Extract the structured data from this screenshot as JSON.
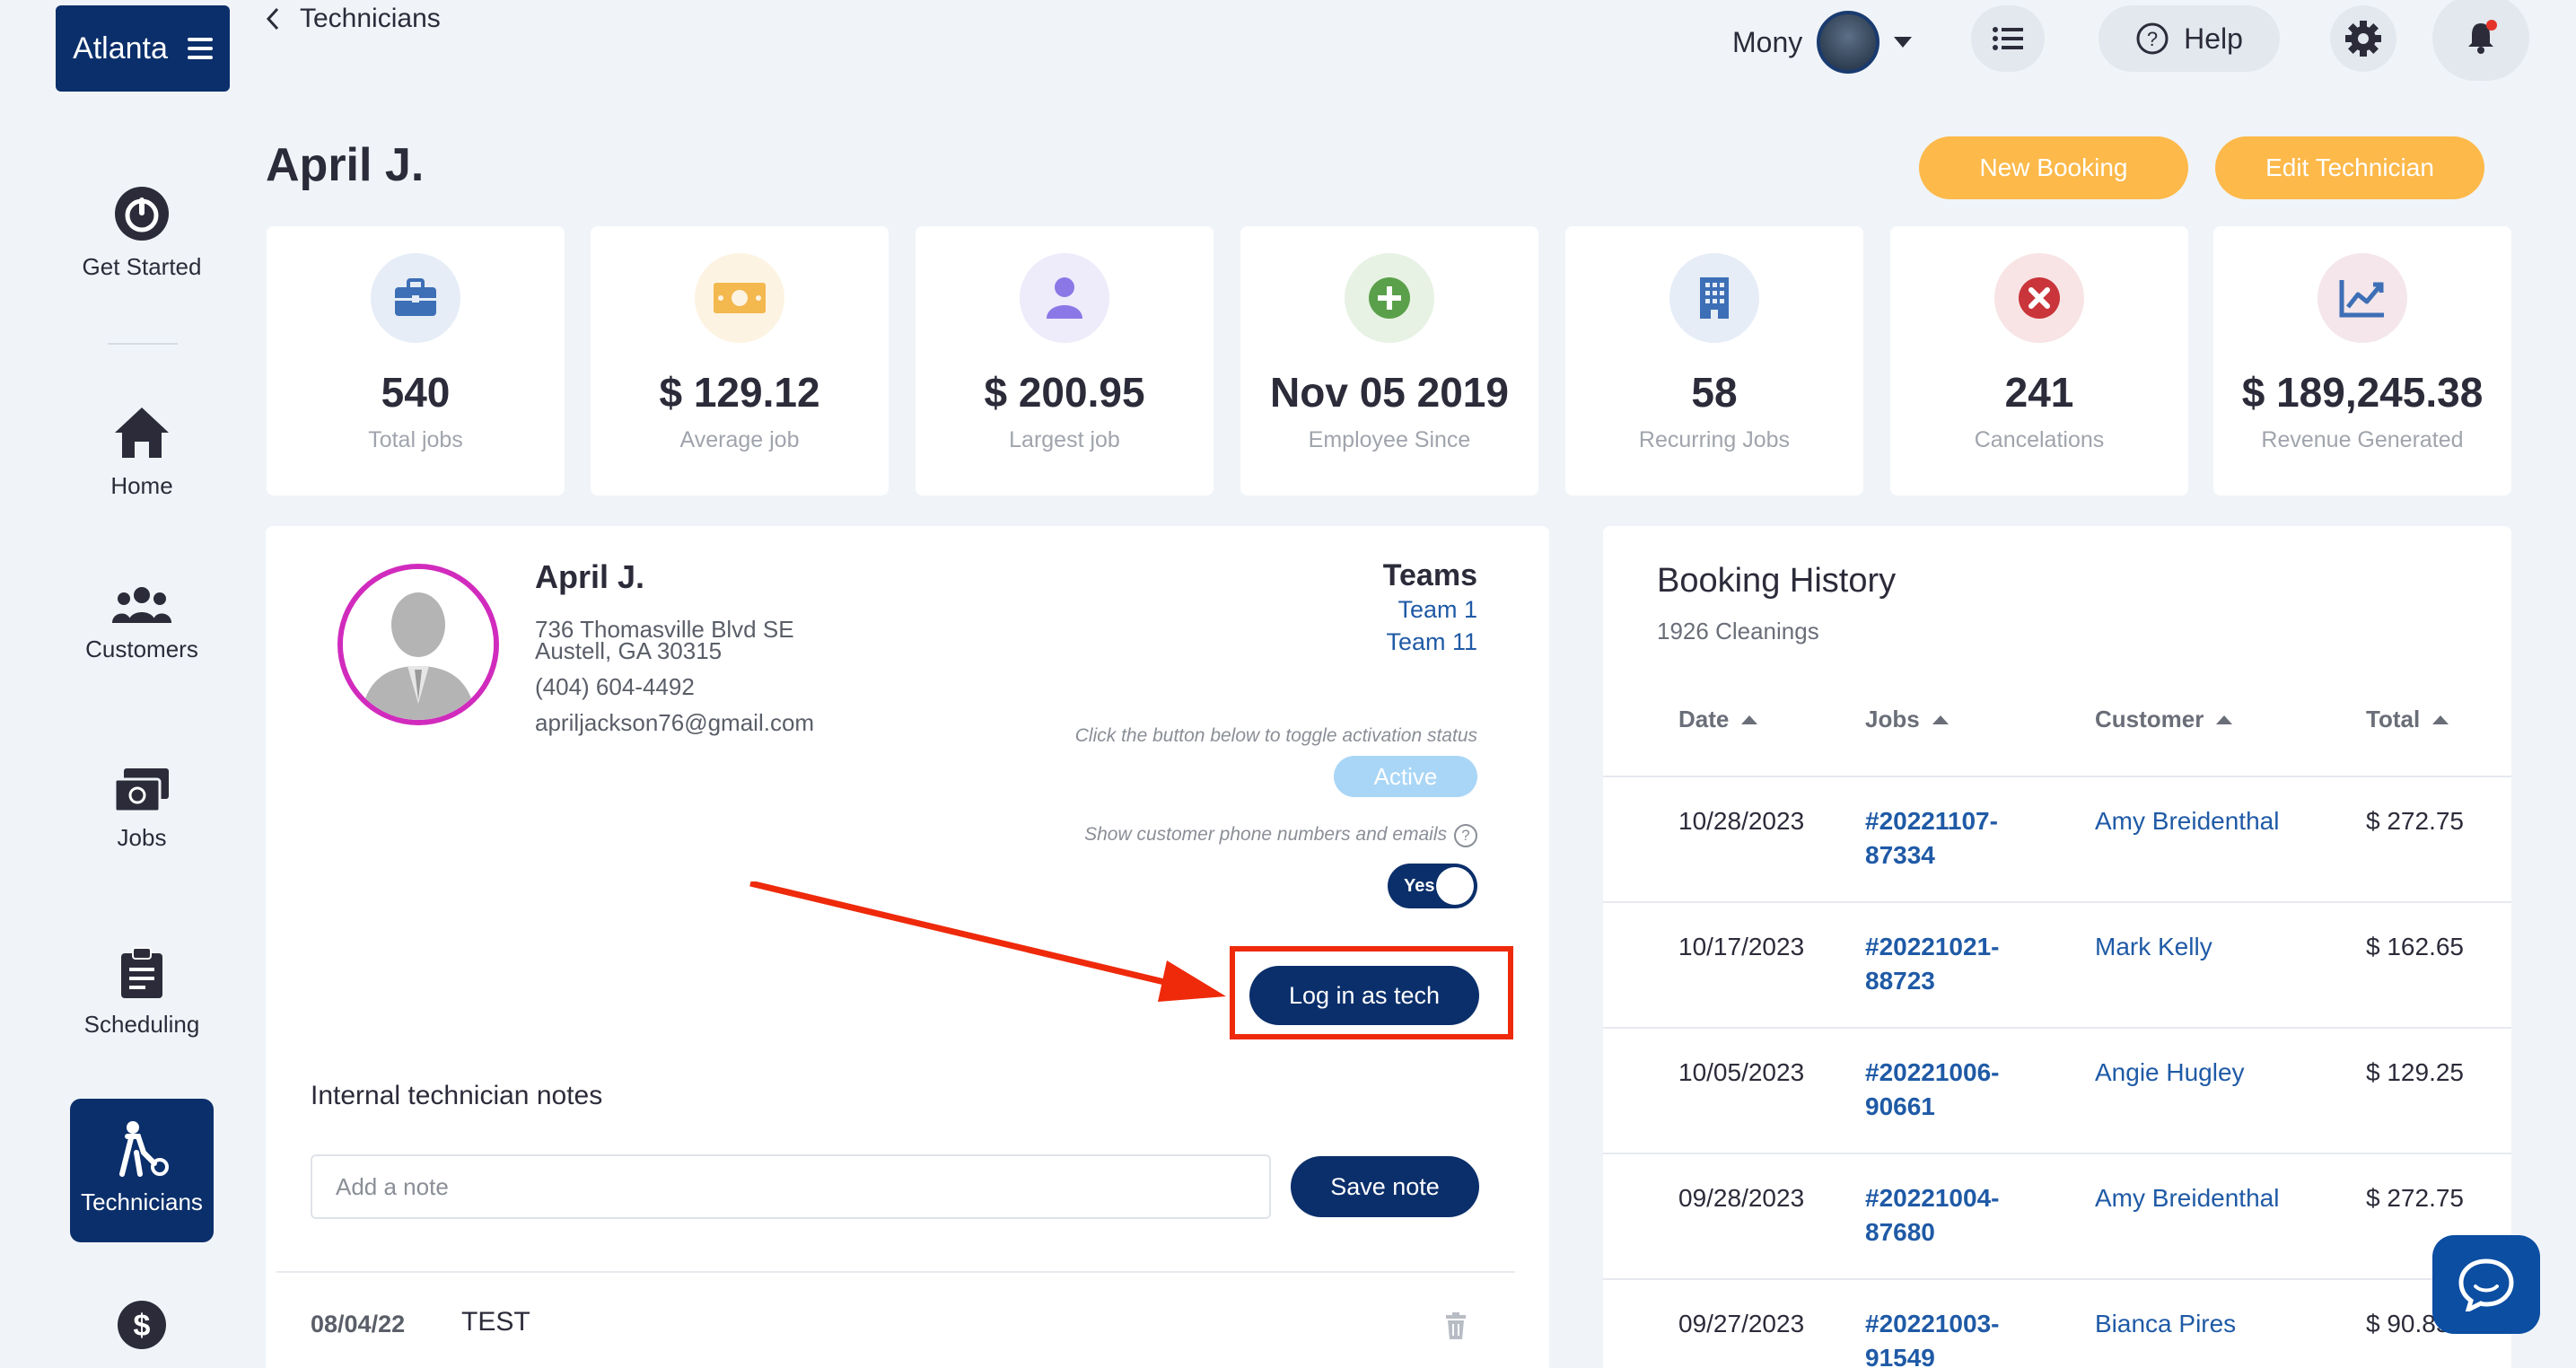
{
  "sidebar": {
    "brand": "Atlanta",
    "items": [
      {
        "label": "Get Started"
      },
      {
        "label": "Home"
      },
      {
        "label": "Customers"
      },
      {
        "label": "Jobs"
      },
      {
        "label": "Scheduling"
      },
      {
        "label": "Technicians"
      }
    ]
  },
  "topbar": {
    "back_label": "Technicians",
    "user_name": "Mony",
    "help_label": "Help"
  },
  "header": {
    "title": "April J.",
    "new_booking": "New Booking",
    "edit_technician": "Edit Technician"
  },
  "stats": [
    {
      "value": "540",
      "label": "Total jobs",
      "icon": "briefcase-icon",
      "color": "#3d6fb6"
    },
    {
      "value": "$ 129.12",
      "label": "Average job",
      "icon": "cash-icon",
      "color": "#f3b84e"
    },
    {
      "value": "$ 200.95",
      "label": "Largest job",
      "icon": "user-icon",
      "color": "#8b78e6"
    },
    {
      "value": "Nov 05 2019",
      "label": "Employee Since",
      "icon": "plus-icon",
      "color": "#5aa04a"
    },
    {
      "value": "58",
      "label": "Recurring Jobs",
      "icon": "building-icon",
      "color": "#3d6fb6"
    },
    {
      "value": "241",
      "label": "Cancelations",
      "icon": "cancel-icon",
      "color": "#c9353a"
    },
    {
      "value": "$ 189,245.38",
      "label": "Revenue Generated",
      "icon": "chart-icon",
      "color": "#3d6fb6"
    }
  ],
  "profile": {
    "name": "April J.",
    "address1": "736 Thomasville Blvd SE",
    "address2": "Austell, GA 30315",
    "phone": "(404) 604-4492",
    "email": "apriljackson76@gmail.com",
    "teams_title": "Teams",
    "teams": [
      "Team 1",
      "Team 11"
    ],
    "toggle_hint": "Click the button below to toggle activation status",
    "status": "Active",
    "phone_hint": "Show customer phone numbers and emails",
    "switch_label": "Yes",
    "login_button": "Log in as tech"
  },
  "notes": {
    "title": "Internal technician notes",
    "placeholder": "Add a note",
    "save_button": "Save note",
    "items": [
      {
        "date": "08/04/22",
        "text": "TEST"
      }
    ]
  },
  "history": {
    "title": "Booking History",
    "subtitle": "1926 Cleanings",
    "columns": [
      "Date",
      "Jobs",
      "Customer",
      "Total"
    ],
    "rows": [
      {
        "date": "10/28/2023",
        "job1": "#20221107-",
        "job2": "87334",
        "customer": "Amy Breidenthal",
        "total": "$ 272.75"
      },
      {
        "date": "10/17/2023",
        "job1": "#20221021-",
        "job2": "88723",
        "customer": "Mark Kelly",
        "total": "$ 162.65"
      },
      {
        "date": "10/05/2023",
        "job1": "#20221006-",
        "job2": "90661",
        "customer": "Angie Hugley",
        "total": "$ 129.25"
      },
      {
        "date": "09/28/2023",
        "job1": "#20221004-",
        "job2": "87680",
        "customer": "Amy Breidenthal",
        "total": "$ 272.75"
      },
      {
        "date": "09/27/2023",
        "job1": "#20221003-",
        "job2": "91549",
        "customer": "Bianca Pires",
        "total": "$ 90.85"
      }
    ]
  }
}
